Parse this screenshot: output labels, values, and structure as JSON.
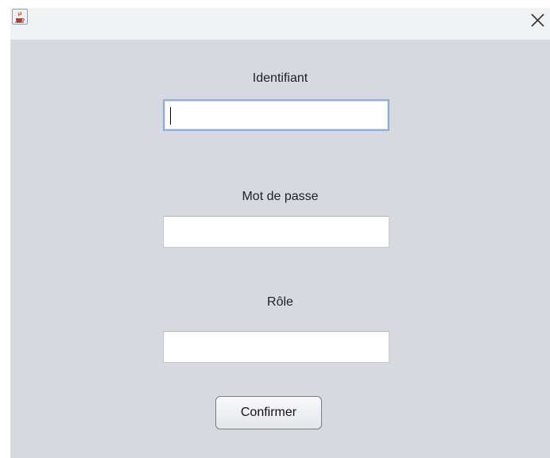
{
  "window": {
    "close_symbol": "✕",
    "app_icon": "java-icon"
  },
  "form": {
    "fields": [
      {
        "label": "Identifiant",
        "value": "",
        "placeholder": ""
      },
      {
        "label": "Mot de passe",
        "value": "",
        "placeholder": ""
      },
      {
        "label": "Rôle",
        "value": "",
        "placeholder": ""
      }
    ],
    "confirm_label": "Confirmer"
  },
  "colors": {
    "window_bg": "#d6d9e0",
    "titlebar_bg": "#f0f1f3",
    "focus_border": "#8eaed6"
  }
}
